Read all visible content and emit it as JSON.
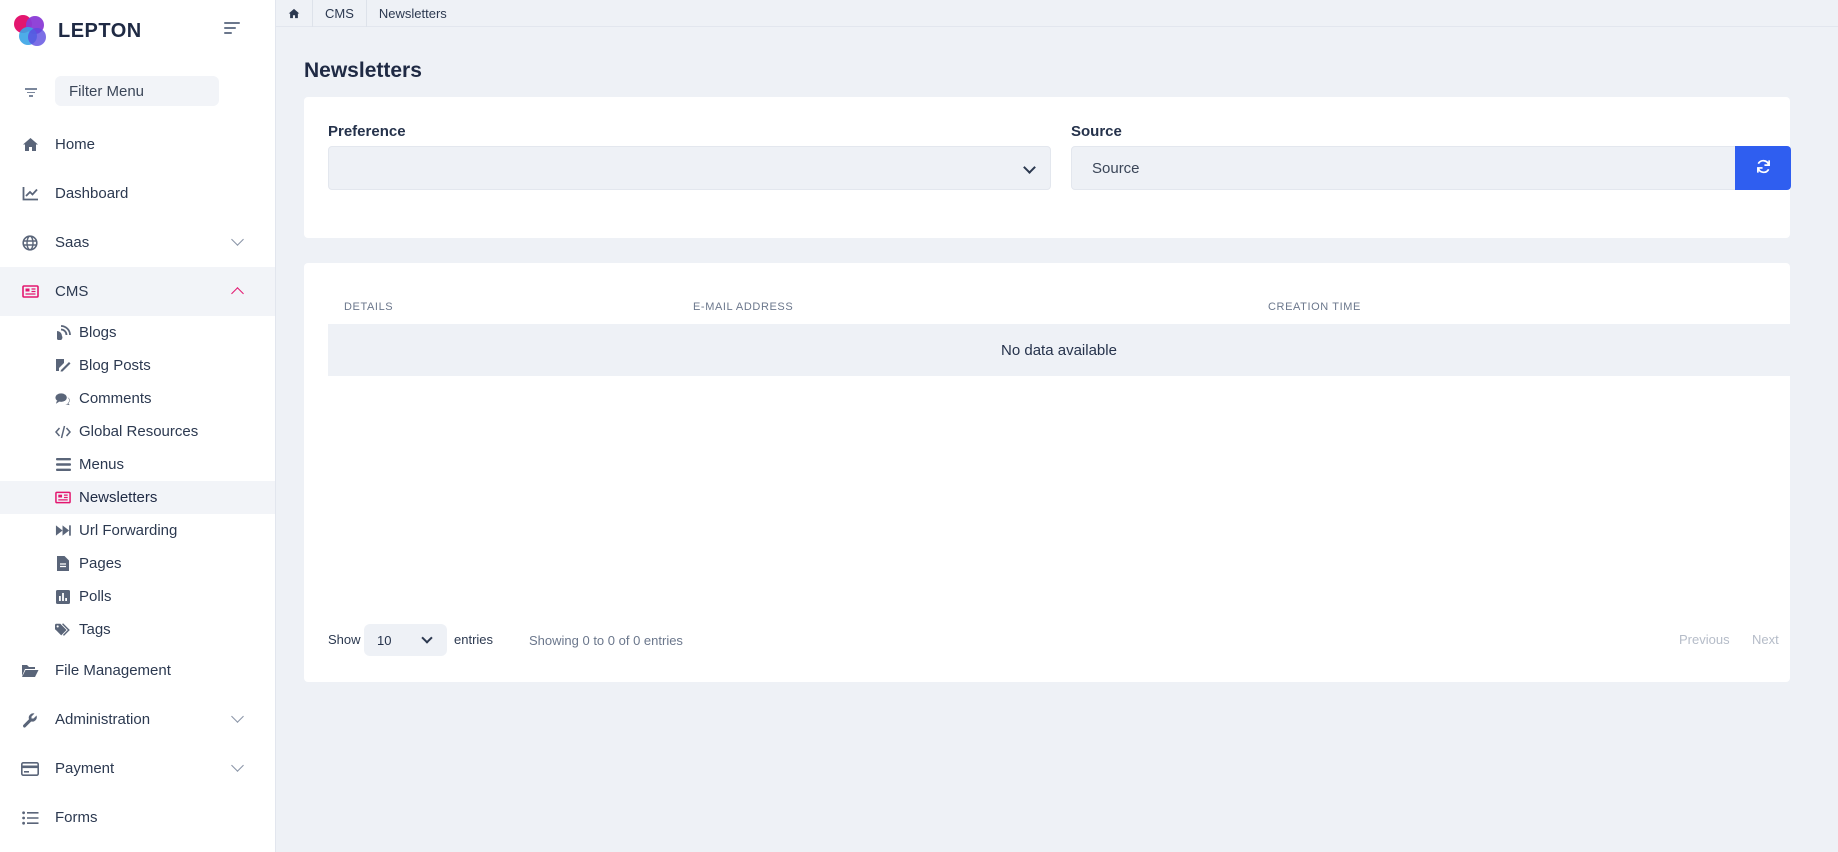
{
  "brand": {
    "name": "LEPTON"
  },
  "filter_menu": {
    "placeholder": "Filter Menu"
  },
  "sidebar": {
    "items": [
      {
        "label": "Home"
      },
      {
        "label": "Dashboard"
      },
      {
        "label": "Saas"
      },
      {
        "label": "CMS"
      },
      {
        "label": "File Management"
      },
      {
        "label": "Administration"
      },
      {
        "label": "Payment"
      },
      {
        "label": "Forms"
      }
    ],
    "cms_children": [
      {
        "label": "Blogs"
      },
      {
        "label": "Blog Posts"
      },
      {
        "label": "Comments"
      },
      {
        "label": "Global Resources"
      },
      {
        "label": "Menus"
      },
      {
        "label": "Newsletters"
      },
      {
        "label": "Url Forwarding"
      },
      {
        "label": "Pages"
      },
      {
        "label": "Polls"
      },
      {
        "label": "Tags"
      }
    ]
  },
  "breadcrumb": {
    "items": [
      "CMS",
      "Newsletters"
    ]
  },
  "page": {
    "title": "Newsletters"
  },
  "filters": {
    "preference_label": "Preference",
    "preference_value": "",
    "source_label": "Source",
    "source_placeholder": "Source"
  },
  "table": {
    "headers": [
      "DETAILS",
      "E-MAIL ADDRESS",
      "CREATION TIME"
    ],
    "empty_text": "No data available"
  },
  "footer": {
    "show_label": "Show",
    "page_size": "10",
    "entries_label": "entries",
    "info": "Showing 0 to 0 of 0 entries",
    "previous": "Previous",
    "next": "Next"
  },
  "colors": {
    "accent": "#e3166f",
    "primary_button": "#2f5ef0",
    "background": "#eef1f6"
  }
}
